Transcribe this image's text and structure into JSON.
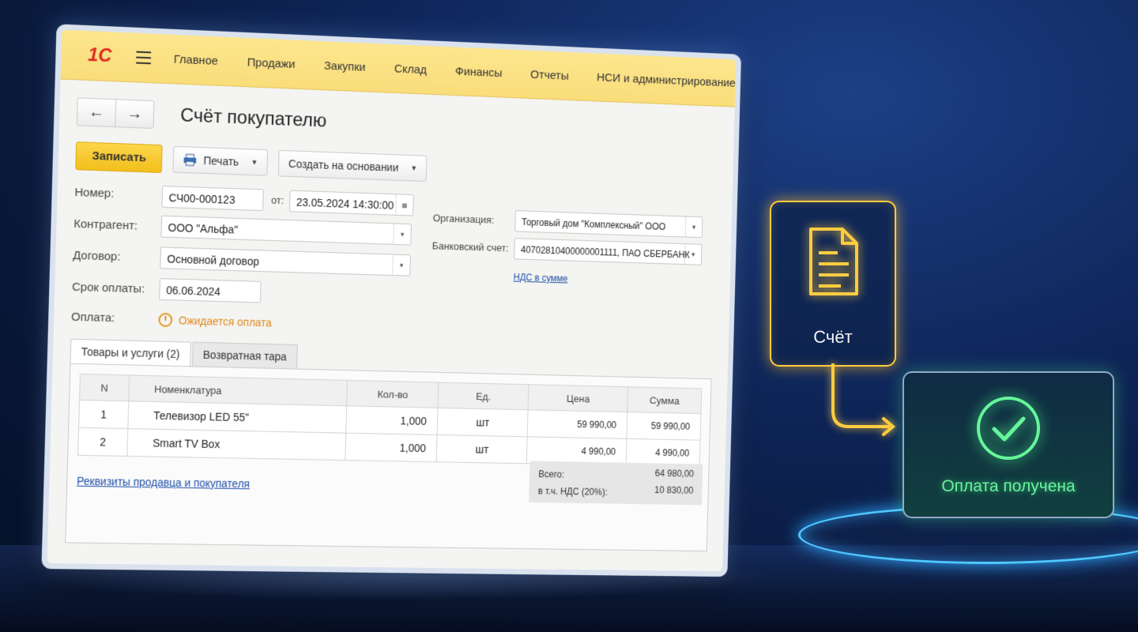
{
  "menu": {
    "logo": "1С",
    "items": [
      "Главное",
      "Продажи",
      "Закупки",
      "Склад",
      "Финансы",
      "Отчеты",
      "НСИ и администрирование"
    ]
  },
  "document": {
    "title": "Счёт покупателю"
  },
  "toolbar": {
    "save_label": "Записать",
    "print_label": "Печать",
    "create_based_label": "Создать на основании"
  },
  "form": {
    "number_label": "Номер:",
    "number_value": "СЧ00-000123",
    "from_label": "от:",
    "date_value": "23.05.2024 14:30:00",
    "counterparty_label": "Контрагент:",
    "counterparty_value": "ООО \"Альфа\"",
    "contract_label": "Договор:",
    "contract_value": "Основной договор",
    "due_label": "Срок оплаты:",
    "due_value": "06.06.2024",
    "payment_label": "Оплата:",
    "payment_status": "Ожидается оплата",
    "organization_label": "Организация:",
    "organization_value": "Торговый дом \"Комплексный\" ООО",
    "bank_label": "Банковский счет:",
    "bank_value": "40702810400000001111, ПАО СБЕРБАНК",
    "vat_link": "НДС в сумме"
  },
  "tabs": [
    "Товары и услуги (2)",
    "Возвратная тара"
  ],
  "table": {
    "headers": [
      "N",
      "Номенклатура",
      "Кол-во",
      "Ед.",
      "Цена",
      "Сумма"
    ],
    "rows": [
      [
        "1",
        "Телевизор LED 55\"",
        "1,000",
        "шт",
        "59 990,00",
        "59 990,00"
      ],
      [
        "2",
        "Smart TV Box",
        "1,000",
        "шт",
        "4 990,00",
        "4 990,00"
      ]
    ]
  },
  "totals": {
    "total_label": "Всего:",
    "total_value": "64 980,00",
    "vat_label": "в т.ч. НДС (20%):",
    "vat_value": "10 830,00"
  },
  "requisites_link": "Реквизиты продавца и покупателя",
  "diagram": {
    "invoice_label": "Счёт",
    "paid_label": "Оплата получена",
    "colors": {
      "invoice": "#ffcc40",
      "paid": "#67f59a",
      "disc": "#4fc7ff"
    }
  }
}
